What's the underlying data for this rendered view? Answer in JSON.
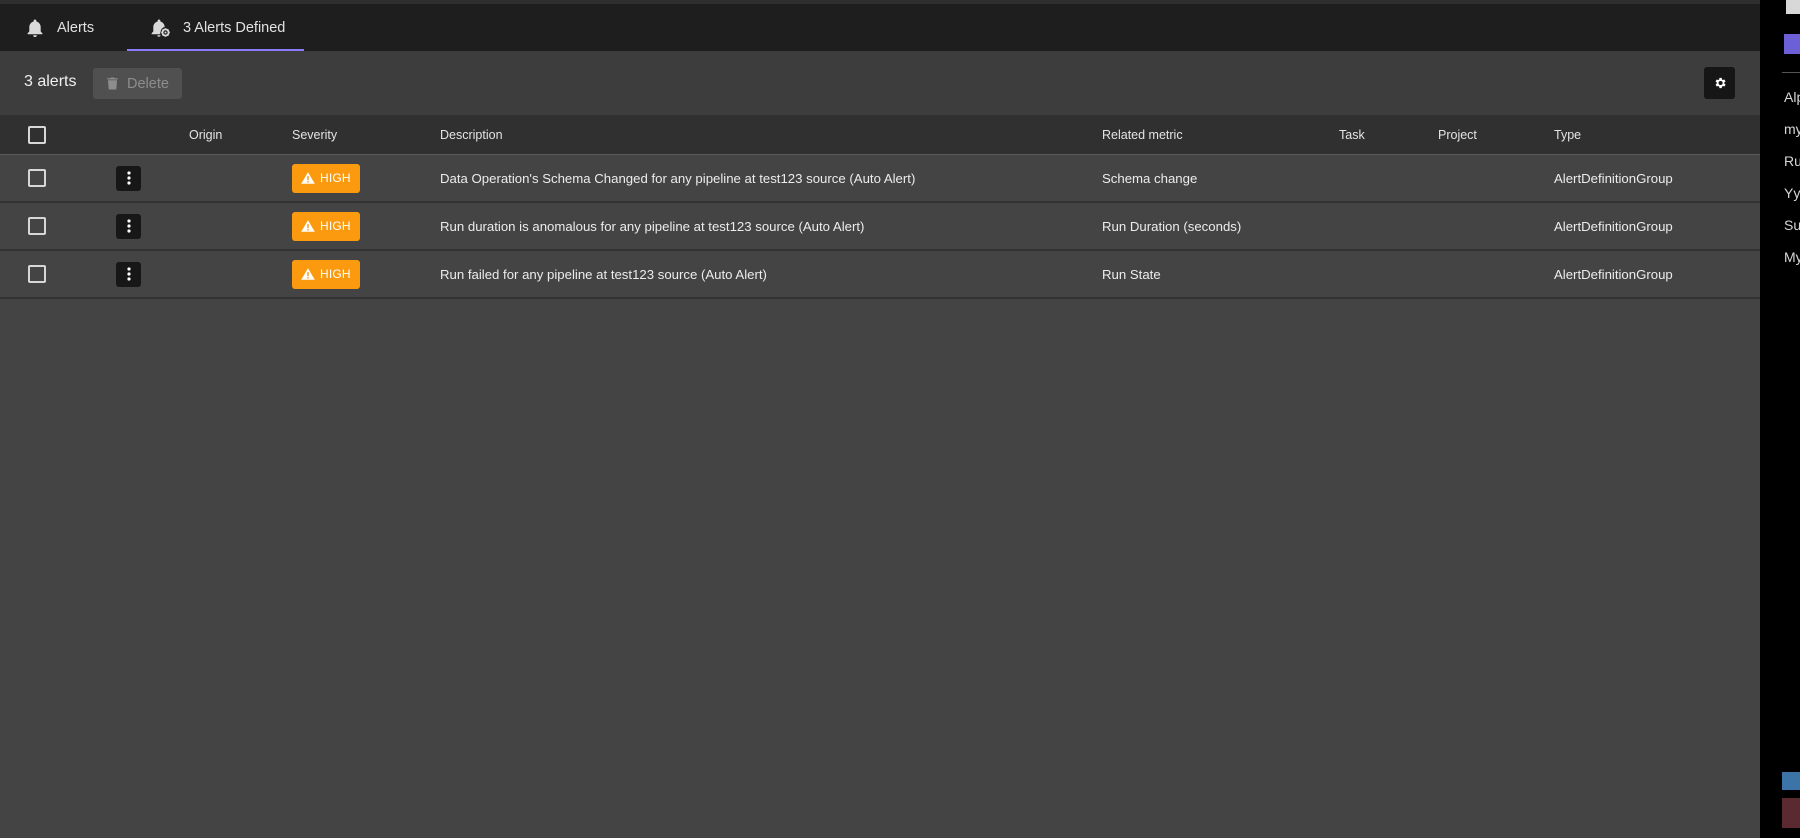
{
  "tabs": [
    {
      "label": "Alerts",
      "icon": "bell-icon",
      "active": false
    },
    {
      "label": "3 Alerts Defined",
      "icon": "bell-settings-icon",
      "active": true
    }
  ],
  "toolbar": {
    "count_label": "3 alerts",
    "delete_label": "Delete",
    "delete_icon": "trash-icon",
    "settings_icon": "gear-icon"
  },
  "table": {
    "columns": {
      "origin": "Origin",
      "severity": "Severity",
      "description": "Description",
      "related_metric": "Related metric",
      "task": "Task",
      "project": "Project",
      "type": "Type"
    },
    "rows": [
      {
        "severity": "HIGH",
        "description": "Data Operation's Schema Changed for any pipeline at test123 source (Auto Alert)",
        "related_metric": "Schema change",
        "task": "",
        "project": "",
        "type": "AlertDefinitionGroup"
      },
      {
        "severity": "HIGH",
        "description": "Run duration is anomalous for any pipeline at test123 source (Auto Alert)",
        "related_metric": "Run Duration (seconds)",
        "task": "",
        "project": "",
        "type": "AlertDefinitionGroup"
      },
      {
        "severity": "HIGH",
        "description": "Run failed for any pipeline at test123 source (Auto Alert)",
        "related_metric": "Run State",
        "task": "",
        "project": "",
        "type": "AlertDefinitionGroup"
      }
    ]
  },
  "side_panel": {
    "items": [
      "Alp",
      "my",
      "Ru",
      "Yy",
      "Su",
      "My"
    ]
  },
  "colors": {
    "severity_high": "#fb9a0e",
    "active_tab_underline": "#8a7cf8",
    "background": "#444444"
  }
}
